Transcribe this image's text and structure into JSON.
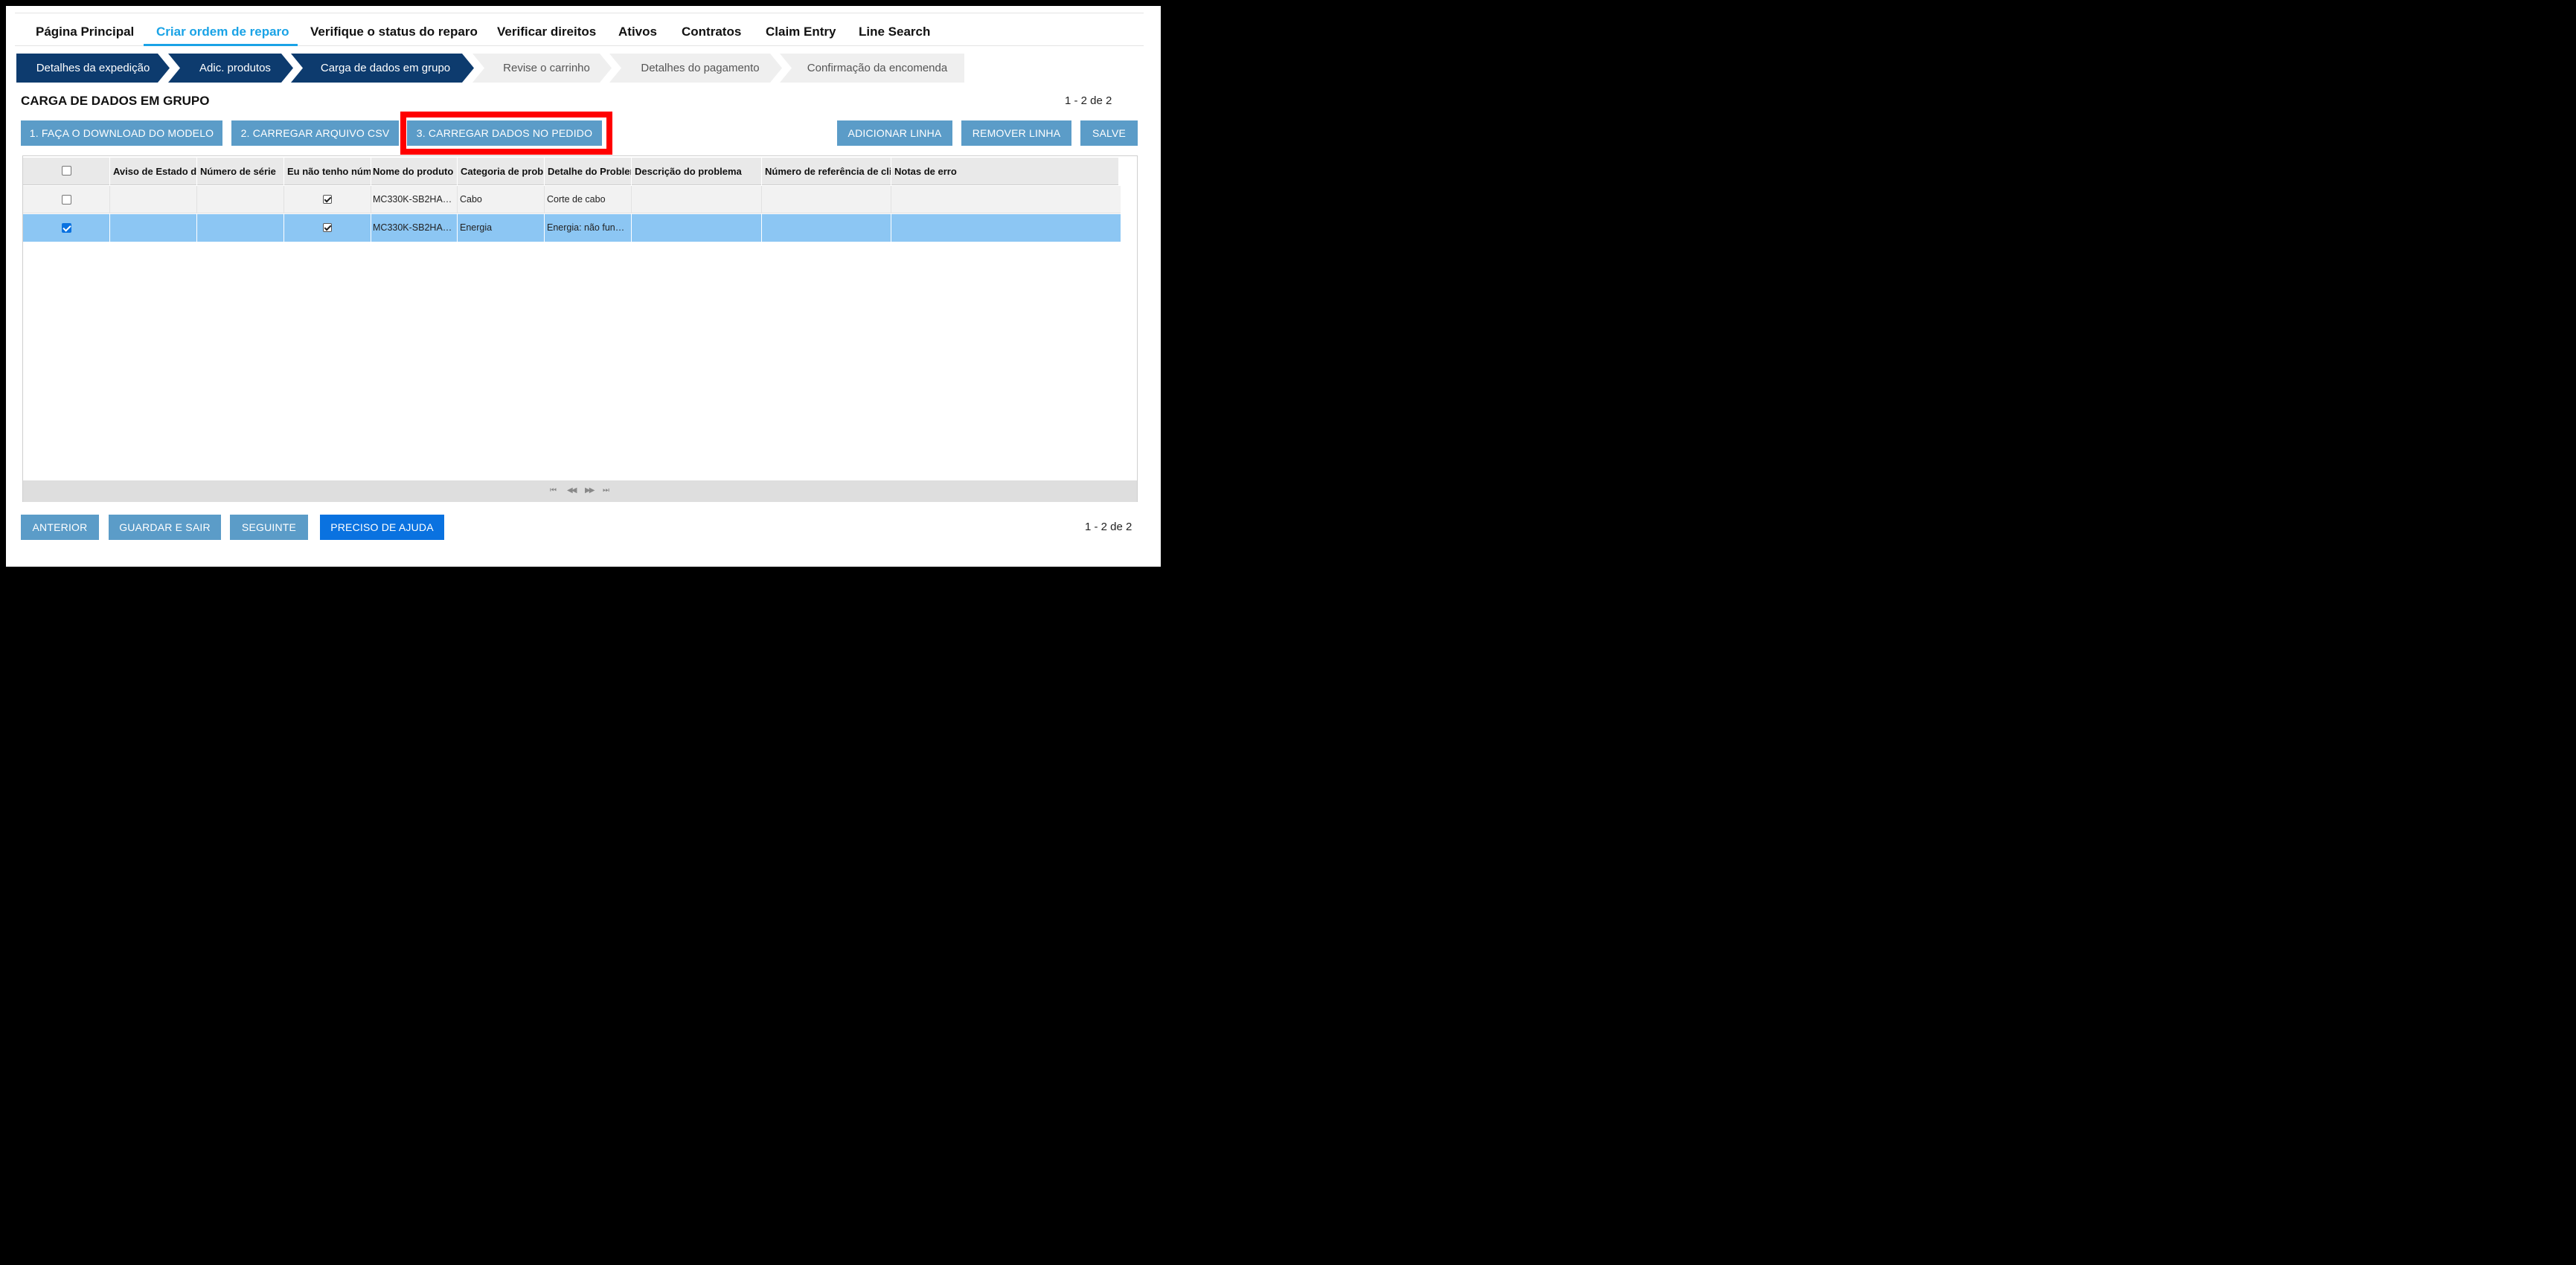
{
  "topnav": {
    "items": [
      {
        "label": "Página Principal"
      },
      {
        "label": "Criar ordem de reparo"
      },
      {
        "label": "Verifique o status do reparo"
      },
      {
        "label": "Verificar direitos"
      },
      {
        "label": "Ativos"
      },
      {
        "label": "Contratos"
      },
      {
        "label": "Claim Entry"
      },
      {
        "label": "Line Search"
      }
    ],
    "active_index": 1
  },
  "steps": [
    {
      "label": "Detalhes da expedição",
      "state": "done"
    },
    {
      "label": "Adic. produtos",
      "state": "done"
    },
    {
      "label": "Carga de dados em grupo",
      "state": "current"
    },
    {
      "label": "Revise o carrinho",
      "state": "todo"
    },
    {
      "label": "Detalhes do pagamento",
      "state": "todo"
    },
    {
      "label": "Confirmação da encomenda",
      "state": "todo"
    }
  ],
  "section": {
    "title": "CARGA DE DADOS EM GRUPO",
    "pager": "1 - 2 de 2"
  },
  "actions": {
    "download_template": "1. FAÇA O DOWNLOAD DO MODELO",
    "upload_csv": "2. CARREGAR ARQUIVO CSV",
    "load_to_order": "3. CARREGAR DADOS NO PEDIDO",
    "add_line": "ADICIONAR LINHA",
    "remove_line": "REMOVER LINHA",
    "save": "SALVE"
  },
  "grid": {
    "columns": [
      "Aviso de Estado d",
      "Número de série",
      "Eu não tenho núm",
      "Nome do produto",
      "Categoria de probl",
      "Detalhe do Probler",
      "Descrição do problema",
      "Número de referência de clie",
      "Notas de erro"
    ],
    "rows": [
      {
        "selected": false,
        "status": "",
        "serial": "",
        "no_serial": true,
        "product": "MC330K-SB2HA…",
        "category": "Cabo",
        "detail": "Corte de cabo",
        "description": "",
        "reference": "",
        "errors": ""
      },
      {
        "selected": true,
        "status": "",
        "serial": "",
        "no_serial": true,
        "product": "MC330K-SB2HA…",
        "category": "Energia",
        "detail": "Energia:  não fun…",
        "description": "",
        "reference": "",
        "errors": ""
      }
    ],
    "nav": {
      "first": "⏮",
      "prev": "◀◀",
      "next": "▶▶",
      "last": "⏭"
    }
  },
  "footer": {
    "previous": "ANTERIOR",
    "save_exit": "GUARDAR E SAIR",
    "next": "SEGUINTE",
    "help": "PRECISO DE AJUDA",
    "pager": "1 - 2 de 2"
  },
  "colors": {
    "accent": "#1aa3e6",
    "step_done": "#0d3b6e",
    "button": "#5b9cc8",
    "button_primary": "#0a72e0",
    "selected_row": "#8cc6f3",
    "highlight": "#ff0000"
  }
}
